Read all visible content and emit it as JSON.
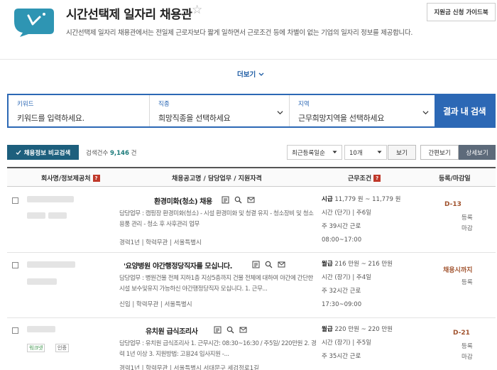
{
  "header": {
    "title": "시간선택제 일자리 채용관",
    "description": "시간선택제 일자리 채용관에서는 전일제 근로자보다 짧게 일하면서 근로조건 등에 차별이 없는 기업의 일자리 정보를 제공합니다.",
    "guide_button": "지원금 신청 가이드북",
    "more_label": "더보기"
  },
  "search": {
    "keyword_label": "키워드",
    "keyword_placeholder": "키워드를 입력하세요.",
    "job_label": "직종",
    "job_value": "희망직종을 선택하세요",
    "region_label": "지역",
    "region_value": "근무희망지역을 선택하세요",
    "submit": "결과 내 검색"
  },
  "toolbar": {
    "compare": "채용정보 비교검색",
    "count_label": "검색건수",
    "count_value": "9,146",
    "count_unit": "건",
    "sort": "최근등록일순",
    "page_size": "10개",
    "view": "보기",
    "simple_view": "간편보기",
    "detail_view": "상세보기"
  },
  "table": {
    "headers": [
      "회사명/정보제공처",
      "채용공고명 / 담당업무 / 지원자격",
      "근무조건",
      "등록/마감일"
    ],
    "rows": [
      {
        "title": "환경미화(청소) 채용",
        "duty": "담당업무 : 캠핑장 환경미화(청소) - 시설 환경미화 및 청결 유지 - 청소장비 및 청소용품 관리 - 청소 후 사후관리 업무",
        "meta": "경력1년 | 학력무관 | 서울특별시",
        "pay_type": "시급",
        "pay": "11,779 원 ~ 11,779 원",
        "hours_type": "시간 (단기)",
        "days": "주6일",
        "weekly": "주 39시간 근로",
        "time": "08:00~17:00",
        "dday": "D-13",
        "reg": "등록",
        "close": "마감"
      },
      {
        "title": "'요양병원 야간행정당직자를 모십니다.",
        "duty": "담당업무 : 병원건물 전체 지하1층 지상5층까지 건물 전체에 대하여 야간에 간단한 시설 보수및유지 가능하신 야간행정당직자 모십니다. 1. 근무...",
        "meta": "신입 | 학력무관 | 서울특별시",
        "pay_type": "월급",
        "pay": "216 만원 ~ 216 만원",
        "hours_type": "시간 (장기)",
        "days": "주4일",
        "weekly": "주 32시간 근로",
        "time": "17:30~09:00",
        "dday": "채용시까지",
        "reg": "등록",
        "close": ""
      },
      {
        "title": "유치원 급식조리사",
        "duty": "담당업무 : 유치원 급식조리사 1. 근무시간: 08:30~16:30 / 주5일/ 220만원 2. 경력 1년 이상 3. 지원방법: 고용24 입사지원 -...",
        "meta": "경력1년 | 학력무관 | 서울특별시 서대문구 세검정로1길",
        "pay_type": "월급",
        "pay": "220 만원 ~ 220 만원",
        "hours_type": "시간 (장기)",
        "days": "주5일",
        "weekly": "주 35시간 근로",
        "time": "",
        "dday": "D-21",
        "reg": "등록",
        "close": "마감",
        "tags": [
          "워크넷",
          "인증"
        ]
      }
    ]
  },
  "colors": {
    "accent": "#2c68b5",
    "dark_btn": "#1d5f7d",
    "logo": "#2e95b3",
    "dday": "#a0522d"
  }
}
